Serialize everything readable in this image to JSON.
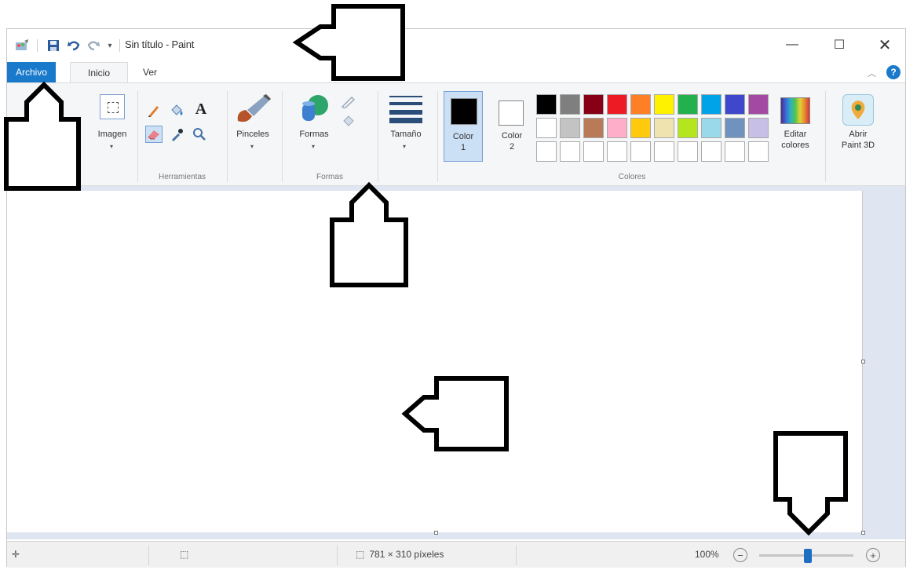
{
  "quick_access": {
    "paint_icon": "paint-app-icon",
    "save_icon": "floppy-icon",
    "undo_icon": "undo-icon",
    "redo_icon": "redo-icon",
    "customize_glyph": "▾"
  },
  "window": {
    "title": "Sin título - Paint",
    "minimize_glyph": "—",
    "maximize_glyph": "☐",
    "close_glyph": "✕"
  },
  "tabs": [
    {
      "label": "Archivo",
      "active": false,
      "highlight": true
    },
    {
      "label": "Inicio",
      "active": true
    },
    {
      "label": "Ver",
      "active": false
    }
  ],
  "ribbon_controls": {
    "collapse_glyph": "︿",
    "help_glyph": "?"
  },
  "ribbon": {
    "imagen": {
      "label": "Imagen",
      "dropdown": "▾"
    },
    "herramientas": {
      "group_label": "Herramientas",
      "text_tool_glyph": "A"
    },
    "pinceles": {
      "label": "Pinceles",
      "dropdown": "▾"
    },
    "formas": {
      "label": "Formas",
      "dropdown": "▾",
      "group_label": "Formas"
    },
    "tamano": {
      "label": "Tamaño",
      "dropdown": "▾"
    },
    "colores": {
      "group_label": "Colores",
      "color1": {
        "label_line1": "Color",
        "label_line2": "1",
        "value": "#000000"
      },
      "color2": {
        "label_line1": "Color",
        "label_line2": "2",
        "value": "#ffffff"
      },
      "palette_row1": [
        "#000000",
        "#7f7f7f",
        "#880015",
        "#ed1c24",
        "#ff7f27",
        "#fff200",
        "#22b14c",
        "#00a2e8",
        "#3f48cc",
        "#a349a4"
      ],
      "palette_row2": [
        "#ffffff",
        "#c3c3c3",
        "#b97a57",
        "#ffaec9",
        "#ffc90e",
        "#efe4b0",
        "#b5e61d",
        "#99d9ea",
        "#7092be",
        "#c8bfe7"
      ],
      "palette_row3": [
        "#ffffff",
        "#ffffff",
        "#ffffff",
        "#ffffff",
        "#ffffff",
        "#ffffff",
        "#ffffff",
        "#ffffff",
        "#ffffff",
        "#ffffff"
      ],
      "edit_colors_line1": "Editar",
      "edit_colors_line2": "colores"
    },
    "paint3d": {
      "label_line1": "Abrir",
      "label_line2": "Paint 3D"
    }
  },
  "status": {
    "cursor_glyph": "✛",
    "selection_glyph": "⬚",
    "size_text": "781 × 310 píxeles",
    "zoom_text": "100%",
    "zoom_out_glyph": "−",
    "zoom_in_glyph": "+",
    "zoom_level_percent": 100
  },
  "theme": {
    "accent": "#1979ca",
    "ribbon_bg": "#f5f6f7",
    "workspace_bg": "#dfe6f1"
  }
}
